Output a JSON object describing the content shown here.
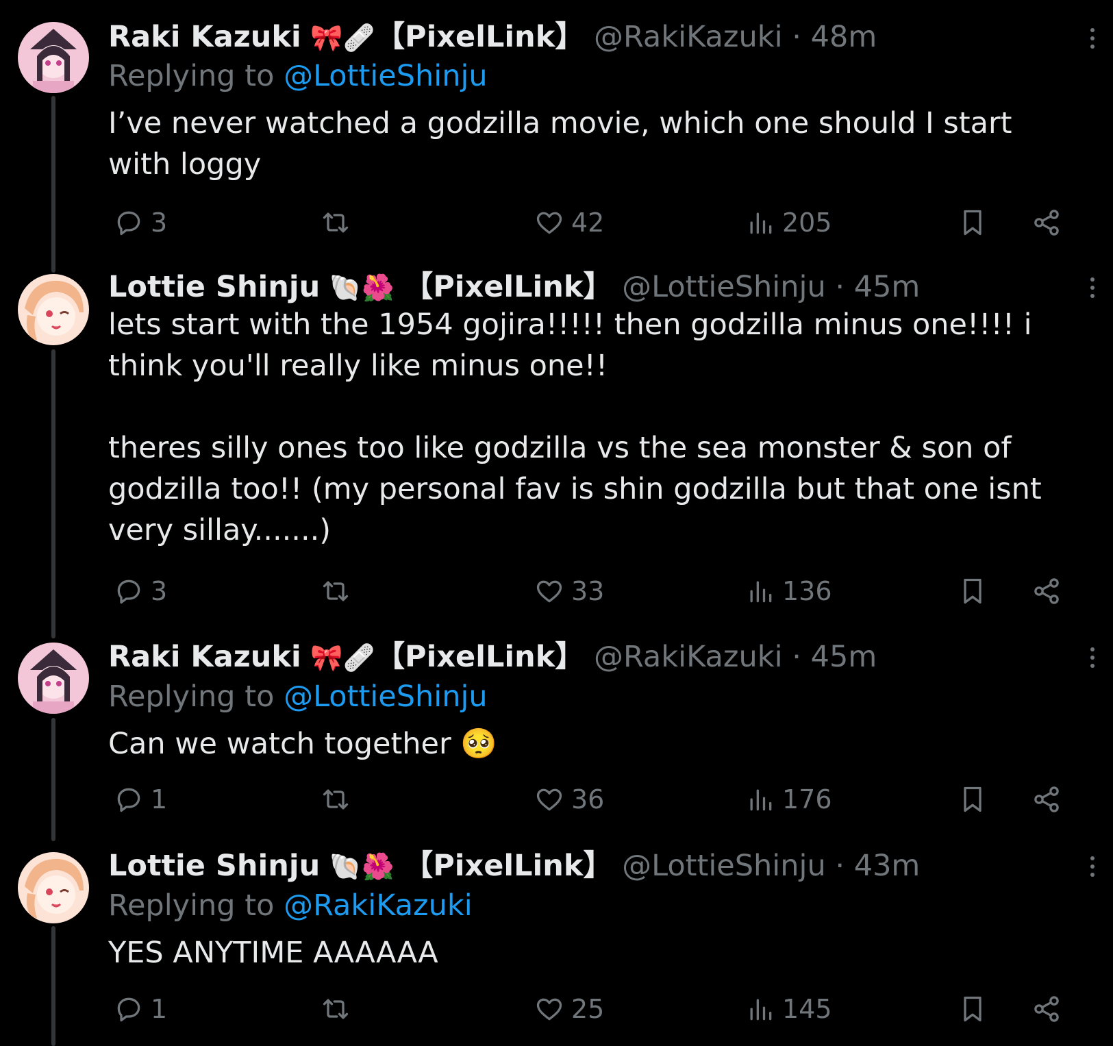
{
  "tweets": [
    {
      "name": "Raki Kazuki",
      "emojis": "🎀🩹",
      "tag": "【PixelLink】",
      "handle": "@RakiKazuki",
      "separator": "·",
      "time": "48m",
      "reply_prefix": "Replying to",
      "reply_to": "@LottieShinju",
      "text": "I’ve never watched a godzilla movie, which one should I start with loggy",
      "replies": "3",
      "retweets": "",
      "likes": "42",
      "views": "205",
      "avatar_colors": [
        "#f3c6d8",
        "#3a2a3a"
      ]
    },
    {
      "name": "Lottie Shinju",
      "emojis": "🐚🌺",
      "tag": "【PixelLink】",
      "handle": "@LottieShinju",
      "separator": "·",
      "time": "45m",
      "reply_prefix": "",
      "reply_to": "",
      "text": "lets start with the 1954 gojira!!!!! then godzilla minus one!!!! i think you'll really like minus one!!\n\ntheres silly ones too like godzilla vs the sea monster & son of godzilla too!! (my personal fav is shin godzilla but that one isnt very sillay.......)",
      "replies": "3",
      "retweets": "",
      "likes": "33",
      "views": "136",
      "avatar_colors": [
        "#fde3d6",
        "#f2b48a"
      ]
    },
    {
      "name": "Raki Kazuki",
      "emojis": "🎀🩹",
      "tag": "【PixelLink】",
      "handle": "@RakiKazuki",
      "separator": "·",
      "time": "45m",
      "reply_prefix": "Replying to",
      "reply_to": "@LottieShinju",
      "text": "Can we watch together 🥺",
      "replies": "1",
      "retweets": "",
      "likes": "36",
      "views": "176",
      "avatar_colors": [
        "#f3c6d8",
        "#3a2a3a"
      ]
    },
    {
      "name": "Lottie Shinju",
      "emojis": "🐚🌺",
      "tag": "【PixelLink】",
      "handle": "@LottieShinju",
      "separator": "·",
      "time": "43m",
      "reply_prefix": "Replying to",
      "reply_to": "@RakiKazuki",
      "text": "YES ANYTIME AAAAAA",
      "replies": "1",
      "retweets": "",
      "likes": "25",
      "views": "145",
      "avatar_colors": [
        "#fde3d6",
        "#f2b48a"
      ]
    }
  ],
  "colors": {
    "background": "#000000",
    "text": "#e7e9ea",
    "muted": "#71767b",
    "link": "#1d9bf0",
    "thread_line": "#333639"
  },
  "icons": [
    "reply-icon",
    "retweet-icon",
    "like-icon",
    "views-icon",
    "bookmark-icon",
    "share-icon",
    "more-icon"
  ]
}
